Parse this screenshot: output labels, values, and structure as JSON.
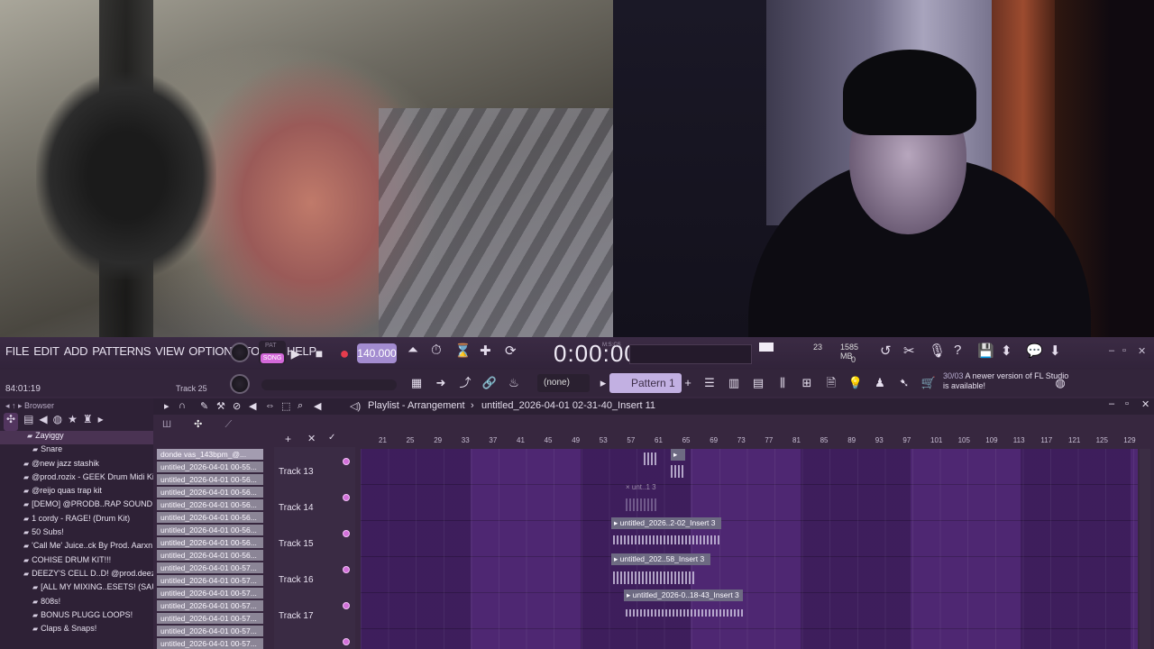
{
  "menu": [
    "FILE",
    "EDIT",
    "ADD",
    "PATTERNS",
    "VIEW",
    "OPTIONS",
    "TOOLS",
    "HELP"
  ],
  "transport": {
    "pat_label": "PAT",
    "song_label": "SONG",
    "play": "▶",
    "stop": "■",
    "record": "●",
    "tempo": "140.000",
    "time": "0:00:00",
    "time_unit": "M:S:CS"
  },
  "performance": {
    "cpu": "23",
    "memory": "1585 MB",
    "polyphony": "0"
  },
  "hint": {
    "position": "84:01:19",
    "track": "Track 25"
  },
  "snap": {
    "value": "(none)"
  },
  "pattern": {
    "name": "Pattern 1",
    "add": "+"
  },
  "news": {
    "date": "30/03",
    "message": "A newer version of FL Studio is available!"
  },
  "browser": {
    "title": "Browser",
    "items": [
      {
        "label": "Zayiggy",
        "type": "folder",
        "selected": true
      },
      {
        "label": "Snare",
        "type": "sub"
      },
      {
        "label": "@new jazz stashik",
        "type": "item"
      },
      {
        "label": "@prod.rozix - GEEK Drum Midi Kit",
        "type": "item"
      },
      {
        "label": "@reijo quas trap kit",
        "type": "item"
      },
      {
        "label": "[DEMO] @PRODB..RAP SOUND KIT",
        "type": "item"
      },
      {
        "label": "1 cordy - RAGE! (Drum Kit)",
        "type": "item"
      },
      {
        "label": "50 Subs!",
        "type": "item"
      },
      {
        "label": "'Call Me' Juice..ck By Prod. Aarxn",
        "type": "item"
      },
      {
        "label": "COHISE DRUM KIT!!!",
        "type": "item"
      },
      {
        "label": "DEEZY'S CELL D..D! @prod.deezy",
        "type": "item"
      },
      {
        "label": "[ALL MY MIXING..ESETS! (SAUCE)",
        "type": "sub"
      },
      {
        "label": "808s!",
        "type": "sub"
      },
      {
        "label": "BONUS PLUGG LOOPS!",
        "type": "sub"
      },
      {
        "label": "Claps & Snaps!",
        "type": "sub"
      }
    ]
  },
  "playlist": {
    "title": "Playlist - Arrangement",
    "arrangement": "untitled_2026-04-01 02-31-40_Insert 11",
    "clip_source_list": [
      "donde vas_143bpm_@...",
      "untitled_2026-04-01 00-55...",
      "untitled_2026-04-01 00-56...",
      "untitled_2026-04-01 00-56...",
      "untitled_2026-04-01 00-56...",
      "untitled_2026-04-01 00-56...",
      "untitled_2026-04-01 00-56...",
      "untitled_2026-04-01 00-56...",
      "untitled_2026-04-01 00-56...",
      "untitled_2026-04-01 00-57...",
      "untitled_2026-04-01 00-57...",
      "untitled_2026-04-01 00-57...",
      "untitled_2026-04-01 00-57...",
      "untitled_2026-04-01 00-57...",
      "untitled_2026-04-01 00-57...",
      "untitled_2026-04-01 00-57..."
    ],
    "ruler": [
      "21",
      "25",
      "29",
      "33",
      "37",
      "41",
      "45",
      "49",
      "53",
      "57",
      "61",
      "65",
      "69",
      "73",
      "77",
      "81",
      "85",
      "89",
      "93",
      "97",
      "101",
      "105",
      "109",
      "113",
      "117",
      "121",
      "125",
      "129"
    ],
    "tracks": [
      "Track 13",
      "Track 14",
      "Track 15",
      "Track 16",
      "Track 17"
    ],
    "clips": [
      {
        "label": "▸ ",
        "bar": 61
      },
      {
        "label": "× unt..1 3",
        "bar": 57
      },
      {
        "label": "▸ untitled_2026..2-02_Insert 3",
        "bar": 55
      },
      {
        "label": "▸ untitled_202..58_Insert 3",
        "bar": 55
      },
      {
        "label": "▸ untitled_2026-0..18-43_Insert 3",
        "bar": 57
      }
    ]
  },
  "colors": {
    "accent": "#d368d9",
    "grid": "#4b2470",
    "tempo_bg": "#a38cd0",
    "pattern_bg": "#c2b0e2"
  }
}
